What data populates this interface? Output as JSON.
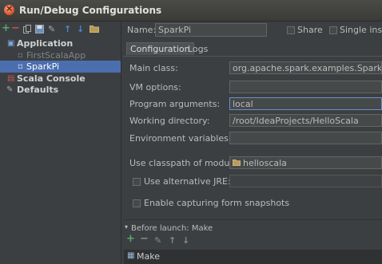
{
  "window": {
    "title": "Run/Debug Configurations"
  },
  "left_toolbar": {
    "icons": [
      "add-icon",
      "remove-icon",
      "copy-icon",
      "save-icon",
      "wrench-icon",
      "move-up-icon",
      "move-down-icon",
      "folder-icon"
    ]
  },
  "tree": {
    "application": "Application",
    "items": [
      "FirstScalaApp",
      "SparkPi"
    ],
    "scala_console": "Scala Console",
    "defaults": "Defaults"
  },
  "header": {
    "name_label": "Name:",
    "name_value": "SparkPi",
    "share_label": "Share",
    "single_instance_label": "Single insta"
  },
  "tabs": [
    "Configuration",
    "Logs"
  ],
  "form": {
    "main_class_label": "Main class:",
    "main_class_value": "org.apache.spark.examples.SparkPi",
    "vm_options_label": "VM options:",
    "vm_options_value": "",
    "program_args_label": "Program arguments:",
    "program_args_value": "local",
    "working_dir_label": "Working directory:",
    "working_dir_value": "/root/IdeaProjects/HelloScala",
    "env_vars_label": "Environment variables:",
    "env_vars_value": "",
    "classpath_label": "Use classpath of module:",
    "classpath_value": "helloscala",
    "alt_jre_label": "Use alternative JRE:",
    "alt_jre_value": "",
    "snapshots_label": "Enable capturing form snapshots"
  },
  "before_launch": {
    "title": "Before launch: Make",
    "toolbar_icons": [
      "add-icon",
      "remove-icon",
      "edit-icon",
      "move-up-icon",
      "move-down-icon"
    ],
    "item": "Make"
  },
  "colors": {
    "background": "#3c3f41",
    "selection": "#4b6eaf",
    "field": "#45494a",
    "accent_green": "#59a869"
  }
}
